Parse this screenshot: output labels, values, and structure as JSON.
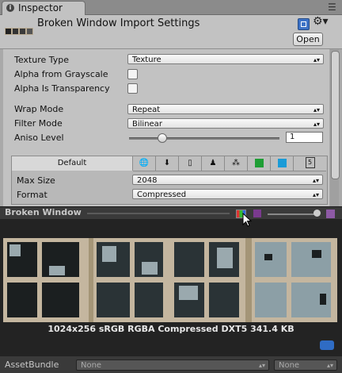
{
  "tab": {
    "label": "Inspector"
  },
  "header": {
    "title": "Broken Window Import Settings",
    "open_label": "Open"
  },
  "fields": [
    {
      "label": "Texture Type",
      "value": "Texture"
    },
    {
      "label": "Alpha from Grayscale"
    },
    {
      "label": "Alpha Is Transparency"
    },
    {
      "label": "Wrap Mode",
      "value": "Repeat"
    },
    {
      "label": "Filter Mode",
      "value": "Bilinear"
    },
    {
      "label": "Aniso Level",
      "value": "1"
    }
  ],
  "platforms": {
    "default_label": "Default",
    "icons": [
      "globe-icon",
      "download-icon",
      "phone-icon",
      "android-icon",
      "blackberry-icon",
      "windows-store-icon",
      "windows-phone-icon",
      "html5-icon"
    ],
    "html5_label": "5"
  },
  "overrides": [
    {
      "label": "Max Size",
      "value": "2048"
    },
    {
      "label": "Format",
      "value": "Compressed"
    }
  ],
  "preview": {
    "title": "Broken Window",
    "info": "1024x256 sRGB  RGBA Compressed DXT5   341.4 KB"
  },
  "asset_bundle": {
    "label": "AssetBundle",
    "name": "None",
    "variant": "None"
  },
  "colors": {
    "panel": "#c2c2c2",
    "preview_bg": "#232323",
    "accent_blue": "#3e73c6"
  }
}
